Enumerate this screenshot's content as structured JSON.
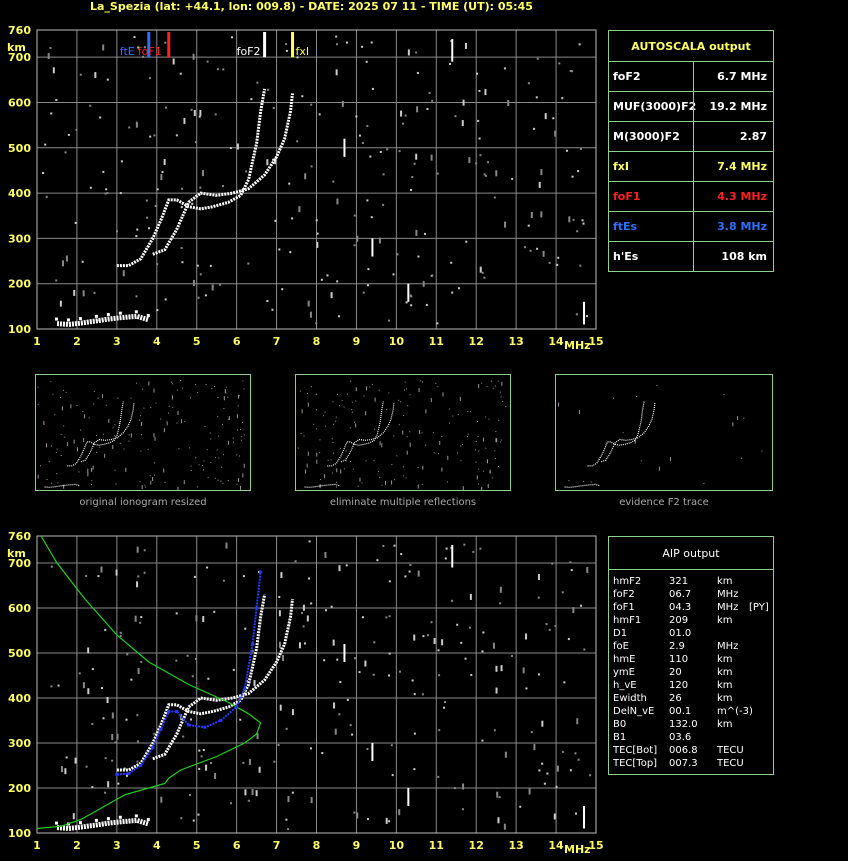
{
  "title": "La_Spezia (lat: +44.1, lon: 009.8) - DATE: 2025 07 11 - TIME (UT): 05:45",
  "colors": {
    "grid": "#8a8a8a",
    "frame": "#8fd08f",
    "yellow": "#ffff66",
    "red": "#ff2020",
    "blue": "#3070ff",
    "green": "#20d020"
  },
  "axis": {
    "x_ticks": [
      "1",
      "2",
      "3",
      "4",
      "5",
      "6",
      "7",
      "8",
      "9",
      "10",
      "11",
      "12",
      "13",
      "14",
      "15"
    ],
    "x_unit": "MHz",
    "y_ticks": [
      "100",
      "200",
      "300",
      "400",
      "500",
      "600",
      "700",
      "760"
    ],
    "y_unit": "km"
  },
  "markers": {
    "ftE": "ftE",
    "foF1": "foF1",
    "foF2": "foF2",
    "fxI": "fxI"
  },
  "autoscala": {
    "header": "AUTOSCALA output",
    "rows": [
      {
        "label": "foF2",
        "value": "6.7 MHz",
        "color": "#ffffff"
      },
      {
        "label": "MUF(3000)F2",
        "value": "19.2 MHz",
        "color": "#ffffff"
      },
      {
        "label": "M(3000)F2",
        "value": "2.87",
        "color": "#ffffff"
      },
      {
        "label": "fxI",
        "value": "7.4 MHz",
        "color": "#ffff66"
      },
      {
        "label": "foF1",
        "value": "4.3 MHz",
        "color": "#ff2020"
      },
      {
        "label": "ftEs",
        "value": "3.8 MHz",
        "color": "#3070ff"
      },
      {
        "label": "h'Es",
        "value": "108    km",
        "color": "#ffffff"
      }
    ]
  },
  "thumbnails": [
    "original ionogram resized",
    "eliminate multiple reflections",
    "evidence F2 trace"
  ],
  "aip": {
    "header": "AIP output",
    "rows": [
      {
        "name": "hmF2",
        "value": "321",
        "unit": "km",
        "extra": ""
      },
      {
        "name": "foF2",
        "value": "06.7",
        "unit": "MHz",
        "extra": ""
      },
      {
        "name": "foF1",
        "value": "04.3",
        "unit": "MHz",
        "extra": "[PY]"
      },
      {
        "name": "hmF1",
        "value": "209",
        "unit": "km",
        "extra": ""
      },
      {
        "name": "D1",
        "value": "01.0",
        "unit": "",
        "extra": ""
      },
      {
        "name": "foE",
        "value": "2.9",
        "unit": "MHz",
        "extra": ""
      },
      {
        "name": "hmE",
        "value": "110",
        "unit": "km",
        "extra": ""
      },
      {
        "name": "ymE",
        "value": "20",
        "unit": "km",
        "extra": ""
      },
      {
        "name": "h_vE",
        "value": "120",
        "unit": "km",
        "extra": ""
      },
      {
        "name": "Ewidth",
        "value": "26",
        "unit": "km",
        "extra": ""
      },
      {
        "name": "DelN_vE",
        "value": "00.1",
        "unit": "m^(-3)",
        "extra": ""
      },
      {
        "name": "B0",
        "value": "132.0",
        "unit": "km",
        "extra": ""
      },
      {
        "name": "B1",
        "value": "03.6",
        "unit": "",
        "extra": ""
      },
      {
        "name": "TEC[Bot]",
        "value": "006.8",
        "unit": "TECU",
        "extra": ""
      },
      {
        "name": "TEC[Top]",
        "value": "007.3",
        "unit": "TECU",
        "extra": ""
      }
    ]
  },
  "chart_data": {
    "type": "scatter",
    "xlim": [
      1,
      15
    ],
    "ylim": [
      100,
      760
    ],
    "marker_freqs": {
      "ftEs": 3.8,
      "foF1": 4.3,
      "foF2": 6.7,
      "fxI": 7.4
    },
    "trace_O": [
      [
        3.0,
        240
      ],
      [
        3.3,
        240
      ],
      [
        3.6,
        255
      ],
      [
        3.9,
        300
      ],
      [
        4.1,
        340
      ],
      [
        4.3,
        385
      ],
      [
        4.5,
        385
      ],
      [
        4.8,
        370
      ],
      [
        5.1,
        365
      ],
      [
        5.4,
        370
      ],
      [
        5.8,
        380
      ],
      [
        6.1,
        395
      ],
      [
        6.3,
        430
      ],
      [
        6.5,
        510
      ],
      [
        6.6,
        580
      ],
      [
        6.7,
        630
      ]
    ],
    "trace_X": [
      [
        3.9,
        265
      ],
      [
        4.2,
        275
      ],
      [
        4.5,
        320
      ],
      [
        4.8,
        380
      ],
      [
        5.1,
        400
      ],
      [
        5.5,
        395
      ],
      [
        5.9,
        400
      ],
      [
        6.3,
        410
      ],
      [
        6.7,
        440
      ],
      [
        7.0,
        480
      ],
      [
        7.2,
        520
      ],
      [
        7.35,
        580
      ],
      [
        7.4,
        620
      ]
    ],
    "trace_Es": [
      [
        1.5,
        112
      ],
      [
        1.8,
        110
      ],
      [
        2.1,
        113
      ],
      [
        2.5,
        118
      ],
      [
        2.8,
        122
      ],
      [
        3.1,
        125
      ],
      [
        3.5,
        128
      ],
      [
        3.8,
        120
      ]
    ],
    "aip_profile_green": [
      [
        1.1,
        760
      ],
      [
        1.5,
        700
      ],
      [
        2.2,
        620
      ],
      [
        3.0,
        540
      ],
      [
        3.8,
        480
      ],
      [
        4.8,
        430
      ],
      [
        5.8,
        390
      ],
      [
        6.3,
        365
      ],
      [
        6.6,
        345
      ],
      [
        6.5,
        320
      ],
      [
        6.2,
        300
      ],
      [
        5.5,
        270
      ],
      [
        4.6,
        240
      ],
      [
        4.3,
        222
      ],
      [
        4.2,
        210
      ],
      [
        3.8,
        200
      ],
      [
        3.2,
        185
      ],
      [
        2.9,
        170
      ],
      [
        2.5,
        150
      ],
      [
        2.1,
        130
      ],
      [
        1.6,
        115
      ],
      [
        1.0,
        110
      ]
    ],
    "aip_trace_blue": [
      [
        3.0,
        230
      ],
      [
        3.3,
        232
      ],
      [
        3.6,
        250
      ],
      [
        3.9,
        290
      ],
      [
        4.1,
        330
      ],
      [
        4.3,
        370
      ],
      [
        4.5,
        370
      ],
      [
        4.8,
        340
      ],
      [
        5.2,
        335
      ],
      [
        5.6,
        350
      ],
      [
        6.0,
        380
      ],
      [
        6.2,
        420
      ],
      [
        6.4,
        520
      ],
      [
        6.5,
        600
      ],
      [
        6.6,
        680
      ]
    ]
  }
}
